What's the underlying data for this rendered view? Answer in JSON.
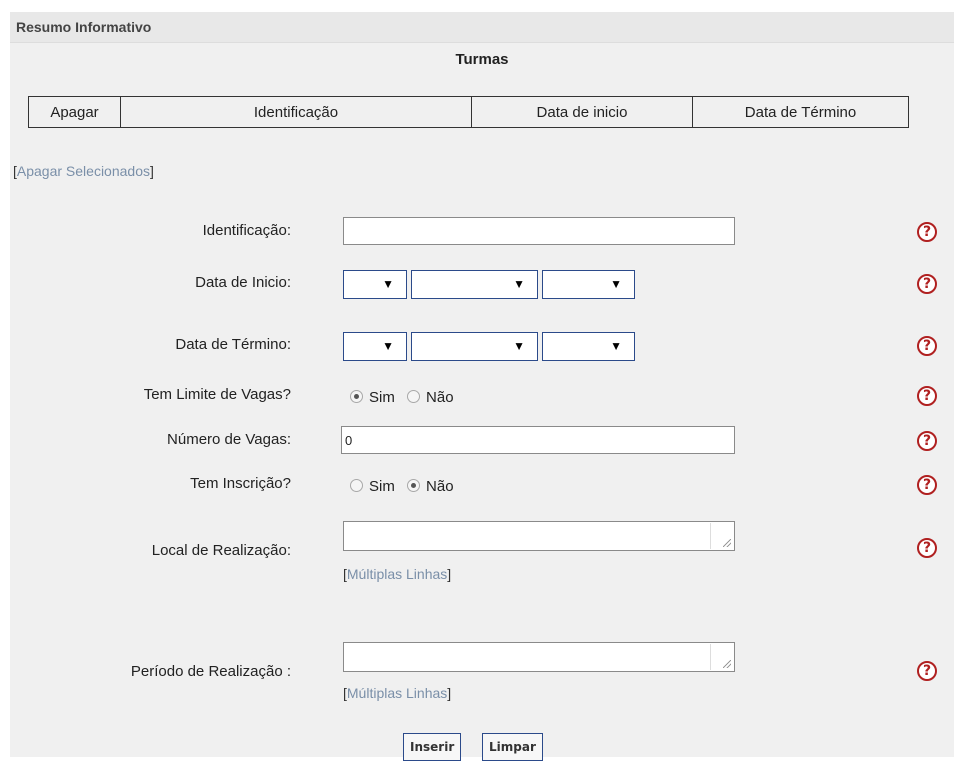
{
  "panel": {
    "title": "Resumo Informativo"
  },
  "table": {
    "caption": "Turmas",
    "headers": [
      "Apagar",
      "Identificação",
      "Data de inicio",
      "Data de Término"
    ]
  },
  "actions": {
    "prefix": "[",
    "apagar_selecionados": "Apagar Selecionados",
    "suffix": "]"
  },
  "form": {
    "identificacao": {
      "label": "Identificação:",
      "value": ""
    },
    "data_inicio": {
      "label": "Data de Inicio:",
      "day": "",
      "month": "",
      "year": ""
    },
    "data_termino": {
      "label": "Data de Término:",
      "day": "",
      "month": "",
      "year": ""
    },
    "limite_vagas": {
      "label": "Tem Limite de Vagas?",
      "options": [
        "Sim",
        "Não"
      ],
      "selected": "Sim"
    },
    "numero_vagas": {
      "label": "Número de Vagas:",
      "value": "0"
    },
    "inscricao": {
      "label": "Tem Inscrição?",
      "options": [
        "Sim",
        "Não"
      ],
      "selected": "Não"
    },
    "local_realizacao": {
      "label": "Local de Realização:",
      "value": "",
      "multiline_link": "Múltiplas Linhas"
    },
    "periodo_realizacao": {
      "label": "Período de Realização :",
      "value": "",
      "multiline_link": "Múltiplas Linhas"
    }
  },
  "icons": {
    "help": "help-circle-icon",
    "dropdown": "triangle-down-icon"
  },
  "glyphs": {
    "help": "?",
    "dropdown_arrow": "▼"
  },
  "buttons": {
    "insert": "Inserir",
    "clear": "Limpar"
  },
  "colors": {
    "help_icon": "#b02020",
    "link": "#7a8fa8",
    "select_border": "#2b4a8a",
    "panel_bg": "#f0f0f0"
  }
}
